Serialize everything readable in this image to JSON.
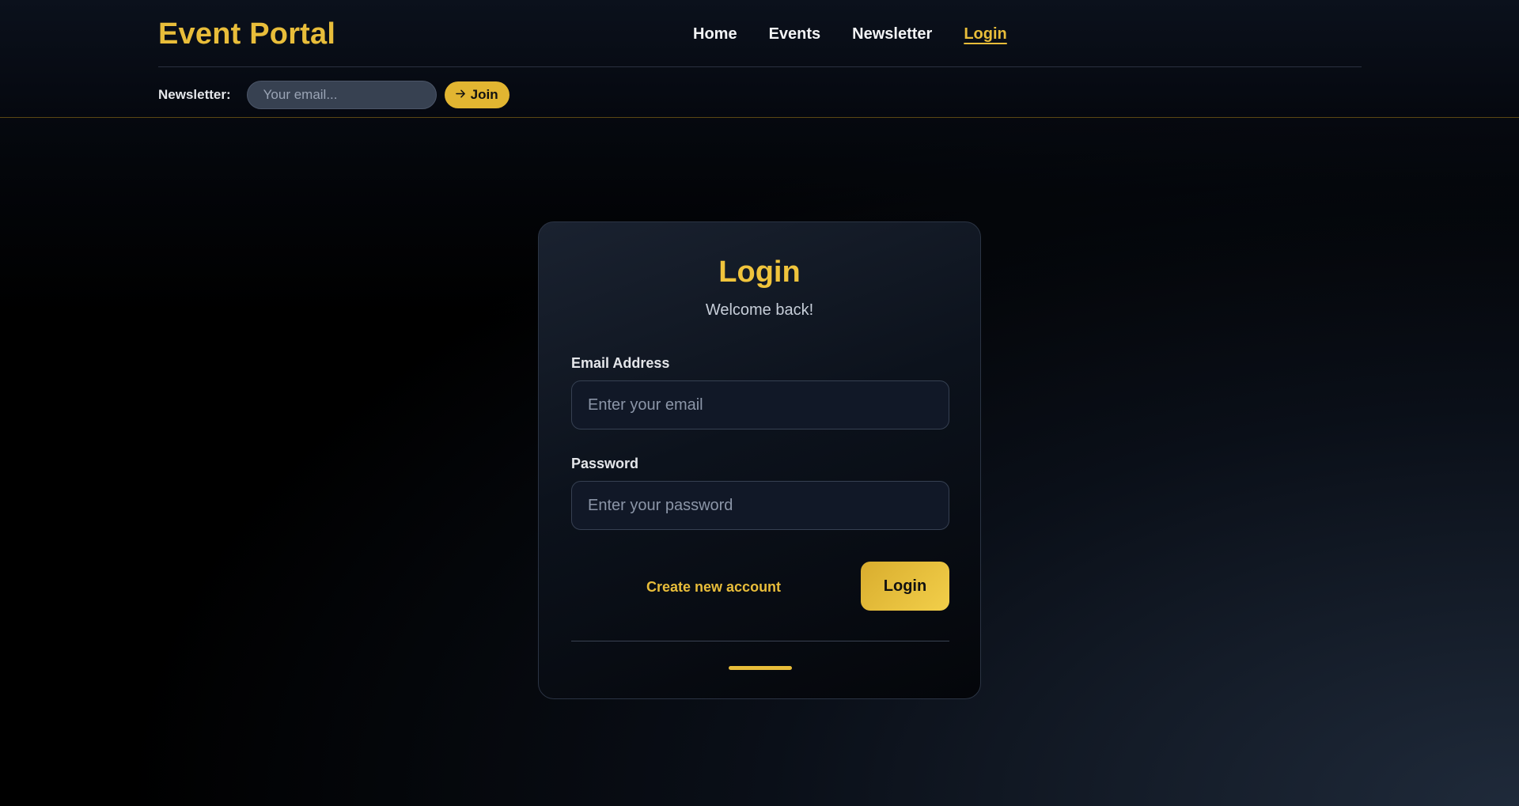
{
  "header": {
    "brand": "Event Portal",
    "nav": [
      {
        "label": "Home",
        "active": false
      },
      {
        "label": "Events",
        "active": false
      },
      {
        "label": "Newsletter",
        "active": false
      },
      {
        "label": "Login",
        "active": true
      }
    ],
    "newsletter": {
      "label": "Newsletter:",
      "placeholder": "Your email...",
      "button_icon": "arrow-right-icon",
      "button_label": "Join"
    }
  },
  "login_card": {
    "title": "Login",
    "subtitle": "Welcome back!",
    "email": {
      "label": "Email Address",
      "placeholder": "Enter your email",
      "value": ""
    },
    "password": {
      "label": "Password",
      "placeholder": "Enter your password",
      "value": ""
    },
    "create_account_link": "Create new account",
    "submit_label": "Login"
  },
  "colors": {
    "accent": "#e8bd3a",
    "background": "#000000",
    "card_border": "#2b3444"
  }
}
